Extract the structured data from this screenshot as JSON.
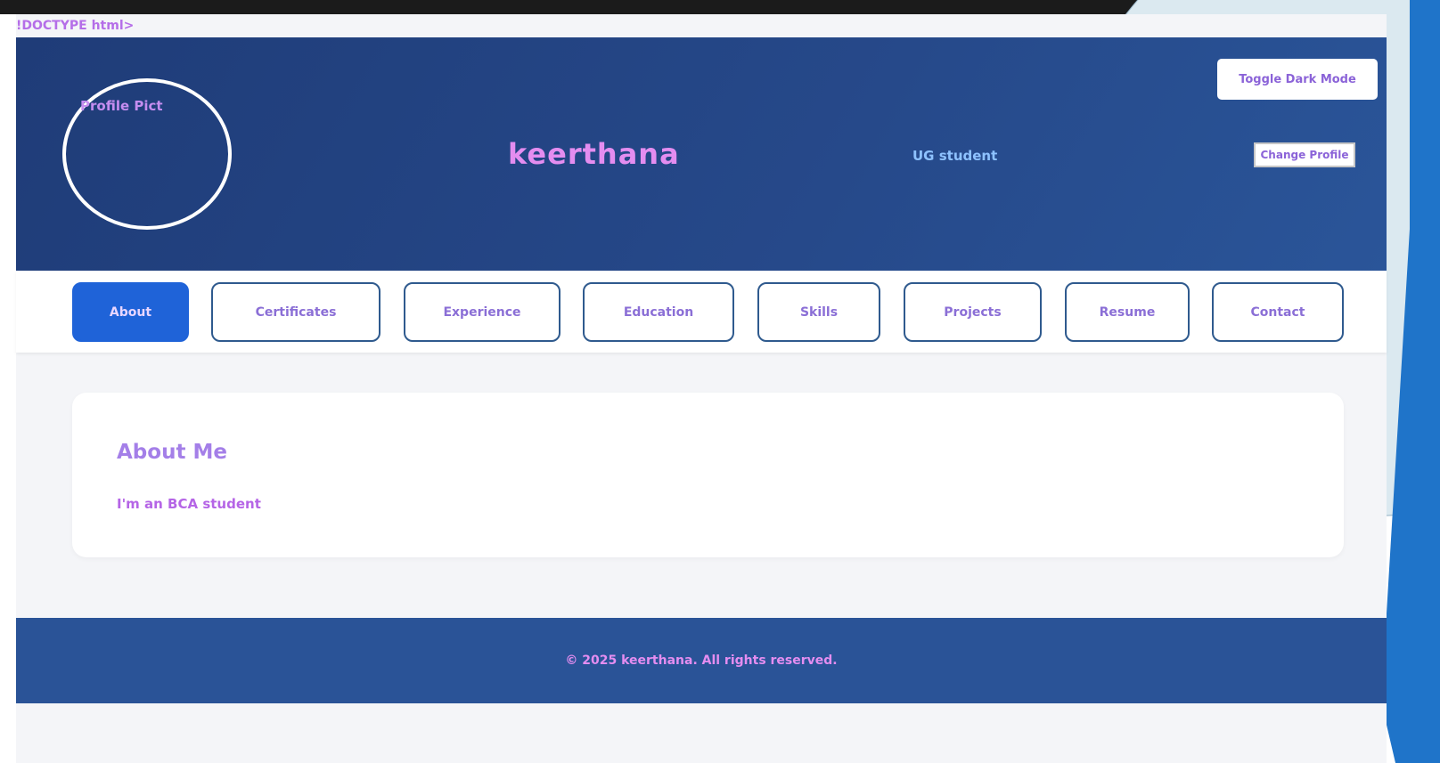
{
  "doctype_text": "!DOCTYPE html>",
  "header": {
    "profile_alt": "Profile Pict",
    "name": "keerthana",
    "tagline": "UG student",
    "toggle_dark_mode": "Toggle Dark Mode",
    "change_profile": "Change Profile"
  },
  "nav": {
    "items": [
      {
        "label": "About"
      },
      {
        "label": "Certificates"
      },
      {
        "label": "Experience"
      },
      {
        "label": "Education"
      },
      {
        "label": "Skills"
      },
      {
        "label": "Projects"
      },
      {
        "label": "Resume"
      },
      {
        "label": "Contact"
      }
    ],
    "active": "About"
  },
  "main": {
    "about_title": "About Me",
    "about_text": "I'm an BCA student"
  },
  "footer": {
    "text": "© 2025 keerthana. All rights reserved."
  },
  "colors": {
    "header_bg": "#26498a",
    "footer_bg": "#2a5397",
    "active_nav": "#1f63d8",
    "nav_border": "#2f5a8e",
    "text_purple": "#b565e6"
  }
}
